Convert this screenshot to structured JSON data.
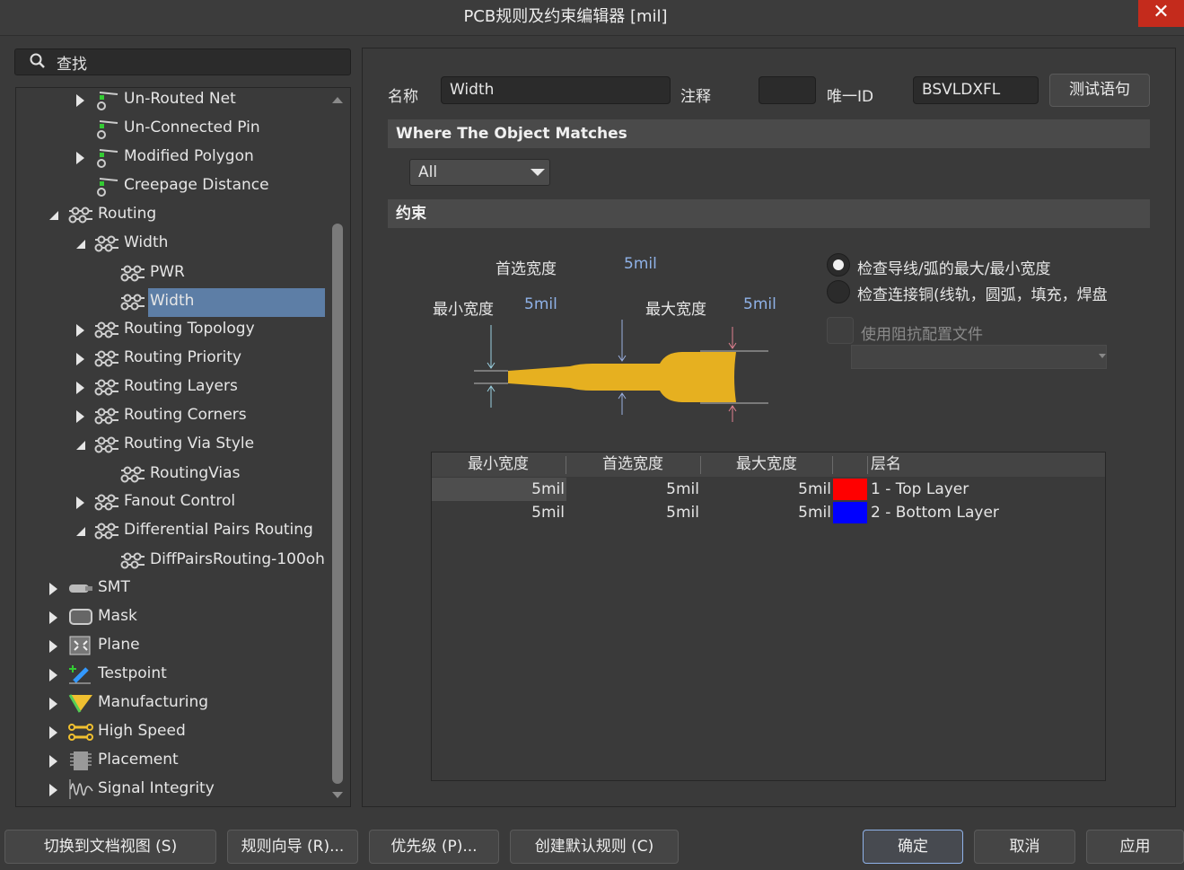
{
  "window": {
    "title": "PCB规则及约束编辑器 [mil]",
    "close_glyph": "✕"
  },
  "search": {
    "label": "查找",
    "icon": "search-icon"
  },
  "tree": {
    "items": [
      {
        "label": "Un-Routed Net",
        "icon": "unrouted-net-icon",
        "expand": "collapsed"
      },
      {
        "label": "Un-Connected Pin",
        "icon": "unconnected-pin-icon",
        "expand": "none"
      },
      {
        "label": "Modified Polygon",
        "icon": "modified-polygon-icon",
        "expand": "collapsed"
      },
      {
        "label": "Creepage Distance",
        "icon": "creepage-distance-icon",
        "expand": "none"
      },
      {
        "label": "Routing",
        "icon": "routing-icon",
        "expand": "expanded"
      },
      {
        "label": "Width",
        "icon": "rule-icon",
        "expand": "expanded"
      },
      {
        "label": "PWR",
        "icon": "rule-icon",
        "expand": "none"
      },
      {
        "label": "Width",
        "icon": "rule-icon",
        "expand": "none",
        "selected": true
      },
      {
        "label": "Routing Topology",
        "icon": "rule-icon",
        "expand": "collapsed"
      },
      {
        "label": "Routing Priority",
        "icon": "rule-icon",
        "expand": "collapsed"
      },
      {
        "label": "Routing Layers",
        "icon": "rule-icon",
        "expand": "collapsed"
      },
      {
        "label": "Routing Corners",
        "icon": "rule-icon",
        "expand": "collapsed"
      },
      {
        "label": "Routing Via Style",
        "icon": "rule-icon",
        "expand": "expanded"
      },
      {
        "label": "RoutingVias",
        "icon": "rule-icon",
        "expand": "none"
      },
      {
        "label": "Fanout Control",
        "icon": "rule-icon",
        "expand": "collapsed"
      },
      {
        "label": "Differential Pairs Routing",
        "icon": "rule-icon",
        "expand": "expanded"
      },
      {
        "label": "DiffPairsRouting-100oh",
        "icon": "rule-icon",
        "expand": "none"
      },
      {
        "label": "SMT",
        "icon": "smt-icon",
        "expand": "collapsed"
      },
      {
        "label": "Mask",
        "icon": "mask-icon",
        "expand": "collapsed"
      },
      {
        "label": "Plane",
        "icon": "plane-icon",
        "expand": "collapsed"
      },
      {
        "label": "Testpoint",
        "icon": "testpoint-icon",
        "expand": "collapsed"
      },
      {
        "label": "Manufacturing",
        "icon": "manufacturing-icon",
        "expand": "collapsed"
      },
      {
        "label": "High Speed",
        "icon": "high-speed-icon",
        "expand": "collapsed"
      },
      {
        "label": "Placement",
        "icon": "placement-icon",
        "expand": "collapsed"
      },
      {
        "label": "Signal Integrity",
        "icon": "signal-integrity-icon",
        "expand": "collapsed"
      }
    ]
  },
  "rule": {
    "name_label": "名称",
    "name_value": "Width",
    "comment_label": "注释",
    "comment_value": "",
    "uid_label": "唯一ID",
    "uid_value": "BSVLDXFL",
    "test_button": "测试语句"
  },
  "where": {
    "header": "Where The Object Matches",
    "scope_value": "All"
  },
  "constraints": {
    "header": "约束",
    "preferred_label": "首选宽度",
    "preferred_value": "5mil",
    "min_label": "最小宽度",
    "min_value": "5mil",
    "max_label": "最大宽度",
    "max_value": "5mil",
    "radio_track_label": "检查导线/弧的最大/最小宽度",
    "radio_copper_label": "检查连接铜(线轨，圆弧，填充，焊盘",
    "radio_selected": "track",
    "impedance_label": "使用阻抗配置文件",
    "trace_color": "#e6b020"
  },
  "table": {
    "headers": [
      "最小宽度",
      "首选宽度",
      "最大宽度",
      "",
      "层名"
    ],
    "rows": [
      {
        "min": "5mil",
        "preferred": "5mil",
        "max": "5mil",
        "color": "#ff0000",
        "layer": "1 - Top Layer"
      },
      {
        "min": "5mil",
        "preferred": "5mil",
        "max": "5mil",
        "color": "#0000ff",
        "layer": "2 - Bottom Layer"
      }
    ]
  },
  "footer": {
    "switch_doc": "切换到文档视图 (S)",
    "rule_wizard": "规则向导 (R)...",
    "priority": "优先级 (P)...",
    "create_default": "创建默认规则 (C)",
    "ok": "确定",
    "cancel": "取消",
    "apply": "应用"
  }
}
